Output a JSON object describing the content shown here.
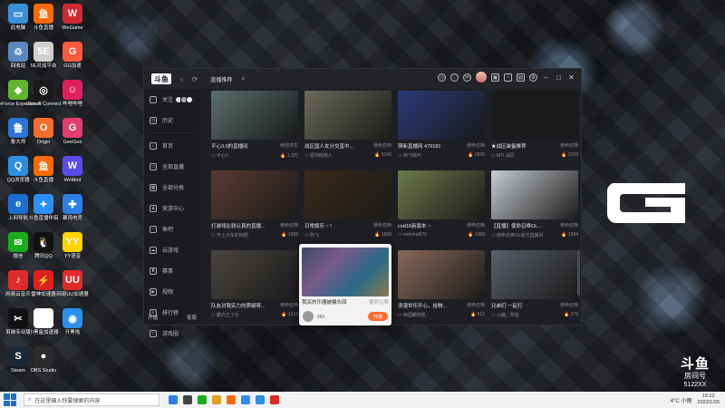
{
  "desktop": {
    "icons": [
      {
        "label": "此电脑",
        "color": "#3b8fd8",
        "glyph": "▭"
      },
      {
        "label": "回收站",
        "color": "#5a88c0",
        "glyph": "♲"
      },
      {
        "label": "GeForce Experience",
        "color": "#5fb52b",
        "glyph": "◆"
      },
      {
        "label": "鲁大师",
        "color": "#2a73d8",
        "glyph": "鲁"
      },
      {
        "label": "QQ浏览器",
        "color": "#2a8fe0",
        "glyph": "Q"
      },
      {
        "label": "上网导航",
        "color": "#1b6fd0",
        "glyph": "e"
      },
      {
        "label": "微信",
        "color": "#1aad19",
        "glyph": "✉"
      },
      {
        "label": "网易云音乐",
        "color": "#e02b2b",
        "glyph": "♪"
      },
      {
        "label": "剪映专业版",
        "color": "#111111",
        "glyph": "✂"
      },
      {
        "label": "Steam",
        "color": "#1b2838",
        "glyph": "S"
      },
      {
        "label": "斗鱼直播",
        "color": "#ff6a00",
        "glyph": "鱼"
      },
      {
        "label": "5E对战平台",
        "color": "#d0d0d0",
        "glyph": "5E"
      },
      {
        "label": "Ubisoft Connect",
        "color": "#1a1a1a",
        "glyph": "◎"
      },
      {
        "label": "Origin",
        "color": "#f56c2d",
        "glyph": "O"
      },
      {
        "label": "斗鱼直播",
        "color": "#ff6a00",
        "glyph": "鱼"
      },
      {
        "label": "斗鱼直播伴侣",
        "color": "#2f8ef4",
        "glyph": "✦"
      },
      {
        "label": "腾讯QQ",
        "color": "#111111",
        "glyph": "🐧"
      },
      {
        "label": "雷神加速器",
        "color": "#e02020",
        "glyph": "⚡"
      },
      {
        "label": "小黑盒加速器",
        "color": "#ffffff",
        "glyph": "◇"
      },
      {
        "label": "OBS Studio",
        "color": "#2b2b2b",
        "glyph": "●"
      },
      {
        "label": "WeGame",
        "color": "#d0292f",
        "glyph": "W"
      },
      {
        "label": "GG加速",
        "color": "#ff5a3c",
        "glyph": "G"
      },
      {
        "label": "哔哩哔哩",
        "color": "#e01f5c",
        "glyph": "☺"
      },
      {
        "label": "GeeGee",
        "color": "#e53c6e",
        "glyph": "G"
      },
      {
        "label": "WeMod",
        "color": "#5a4ce8",
        "glyph": "W"
      },
      {
        "label": "暴鸡电竞",
        "color": "#2b7fe8",
        "glyph": "✚"
      },
      {
        "label": "YY语音",
        "color": "#ffd400",
        "glyph": "YY"
      },
      {
        "label": "网易UU加速器",
        "color": "#e02b2b",
        "glyph": "UU"
      },
      {
        "label": "开黑啦",
        "color": "#2b90ef",
        "glyph": "◉"
      }
    ]
  },
  "watermark": {
    "logo": "斗鱼",
    "room_label": "房间号",
    "room_number": "5122XX"
  },
  "app": {
    "logo": "斗鱼",
    "nav_back": "‹",
    "nav_refresh": "⟳",
    "tab_label": "直播推荐",
    "search_icon": "⌕",
    "window_controls": [
      "–",
      "□",
      "✕"
    ],
    "sidebar": {
      "items": [
        {
          "label": "关注",
          "icon": "heart-icon",
          "glyph": "♡"
        },
        {
          "label": "历史",
          "icon": "clock-icon",
          "glyph": "◷"
        },
        {
          "label": "首页",
          "icon": "home-icon",
          "glyph": "⌂"
        },
        {
          "label": "全部直播",
          "icon": "tv-icon",
          "glyph": "▭"
        },
        {
          "label": "全部分类",
          "icon": "grid-icon",
          "glyph": "▦"
        },
        {
          "label": "竞游中心",
          "icon": "gamepad-icon",
          "glyph": "◈"
        },
        {
          "label": "鱼吧",
          "icon": "fish-icon",
          "glyph": "∽"
        },
        {
          "label": "云游戏",
          "icon": "cloud-icon",
          "glyph": "☁"
        },
        {
          "label": "赛事",
          "icon": "trophy-icon",
          "glyph": "♜"
        },
        {
          "label": "视频",
          "icon": "video-icon",
          "glyph": "▶"
        },
        {
          "label": "排行榜",
          "icon": "rank-icon",
          "glyph": "≡"
        },
        {
          "label": "游戏圈",
          "icon": "circle-icon",
          "glyph": "○"
        }
      ],
      "bottom_left": "开播",
      "bottom_right": "客服"
    },
    "cards": [
      {
        "title": "平心3.0的直播间",
        "category": "绝地求生",
        "streamer": "平心0",
        "viewers": "1.3万",
        "thumb": "#5a6f6b"
      },
      {
        "title": "战区国人女分交直中...",
        "category": "使命召唤",
        "streamer": "斑鸠桃桃人",
        "viewers": "5145",
        "thumb": "#6b6a5a"
      },
      {
        "title": "萌新直播间 479181",
        "category": "使命召唤",
        "streamer": "阿飞桃叶",
        "viewers": "2835",
        "thumb": "#2a3a7a"
      },
      {
        "title": "★战区装备推荐",
        "category": "使命召唤",
        "streamer": "MTI 战区",
        "viewers": "2209",
        "thumb": "#1b1b1b"
      },
      {
        "title": "打游戏比较认真的直播...",
        "category": "使命召唤",
        "streamer": "开上大车的阿肥",
        "viewers": "1908",
        "thumb": "#5a3a30"
      },
      {
        "title": "日常娱乐 ~ !",
        "category": "使命召唤",
        "streamer": "阿飞",
        "viewers": "1836",
        "thumb": "#3a2a1a"
      },
      {
        "title": "cod16新版本 ~",
        "category": "使命召唤",
        "streamer": "notmind576",
        "viewers": "1388",
        "thumb": "#6f7a4a"
      },
      {
        "title": "【直播】使命召唤OL...",
        "category": "使命召唤",
        "streamer": "使命召唤OL官方直播间",
        "viewers": "1284",
        "thumb": "#c8ccd0"
      },
      {
        "title": "队友对我实力的质疑呀...",
        "category": "使命召唤",
        "streamer": "霸刃王丁乐",
        "viewers": "1216",
        "thumb": "#4a4540"
      },
      {
        "title": "浪漫世乐开心，拾物...",
        "category": "使命召唤",
        "streamer": "西国霸阿凯",
        "viewers": "512",
        "thumb": "#8a6a5a"
      },
      {
        "title": "兄弟们 一起打",
        "category": "使命召唤",
        "streamer": "小鹿，罗堡",
        "viewers": "379",
        "thumb": "#5a5f68"
      }
    ],
    "popup": {
      "title": "我买的乐器被骗头回",
      "category": "使命召唤",
      "name": "680",
      "button": "开播"
    }
  },
  "taskbar": {
    "search_placeholder": "在这里输入你要搜索的内容",
    "weather": "4°C 小雨",
    "time": "19:22",
    "date": "2022/1/26",
    "apps": [
      "#2b7fe8",
      "#444",
      "#1aad19",
      "#e0a020",
      "#ff6a00",
      "#2f8ef4",
      "#2a8fe0",
      "#e0281f"
    ]
  }
}
